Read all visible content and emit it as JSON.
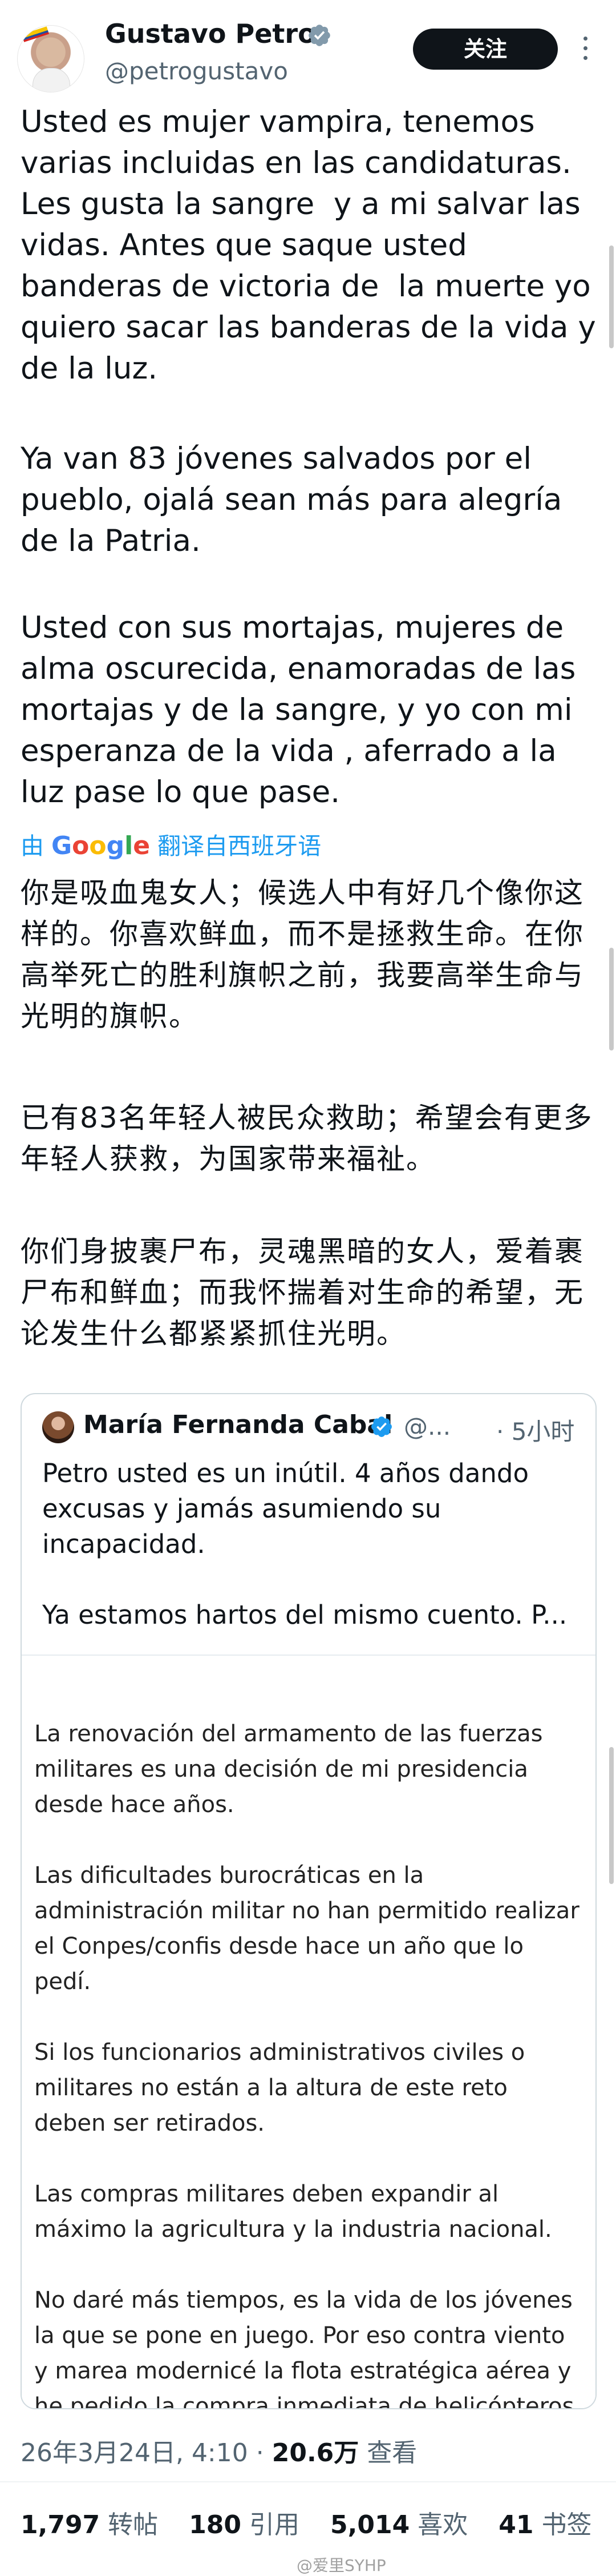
{
  "author": {
    "name": "Gustavo Petro",
    "handle": "@petrogustavo",
    "follow_label": "关注"
  },
  "tweet": {
    "para1": "Usted es mujer vampira, tenemos varias incluidas en las candidaturas. Les gusta la sangre  y a mi salvar las vidas. Antes que saque usted banderas de victoria de  la muerte yo quiero sacar las banderas de la vida y de la luz.",
    "para2": "Ya van 83 jóvenes salvados por el pueblo, ojalá sean más para alegría de la Patria.",
    "para3": "Usted con sus mortajas, mujeres de alma oscurecida, enamoradas de las mortajas y de la sangre, y yo con mi esperanza de la vida , aferrado a la luz pase lo que pase."
  },
  "translation": {
    "prefix": "由",
    "google": [
      "G",
      "o",
      "o",
      "g",
      "l",
      "e"
    ],
    "label": "翻译自西班牙语",
    "para1": "你是吸血鬼女人；候选人中有好几个像你这样的。你喜欢鲜血，而不是拯救生命。在你高举死亡的胜利旗帜之前，我要高举生命与光明的旗帜。",
    "para2": "已有83名年轻人被民众救助；希望会有更多年轻人获救，为国家带来福祉。",
    "para3": "你们身披裹尸布，灵魂黑暗的女人，爱着裹尸布和鲜血；而我怀揣着对生命的希望，无论发生什么都紧紧抓住光明。"
  },
  "quote": {
    "name": "María Fernanda Cabal",
    "handle": "@...",
    "time": "5小时",
    "text": "Petro usted es un inútil. 4 años dando excusas y jamás asumiendo su incapacidad.",
    "text2": "Ya estamos hartos del mismo cuento. P...",
    "image_text": "La renovación del armamento de las fuerzas militares es una decisión de mi presidencia desde hace años.\n\nLas dificultades burocráticas en la administración militar no han permitido realizar el Conpes/confis desde hace un año que lo pedí.\n\nSi los funcionarios administrativos civiles o militares no están a la altura de este reto deben ser retirados.\n\nLas compras militares deben expandir al máximo la agricultura y la industria nacional.\n\nNo daré más tiempos, es la vida de los jóvenes la que se pone en juego. Por eso contra viento y marea modernicé la flota estratégica aérea y he pedido la compra inmediata de helicópteros y aviones de carga y tropa para ampliar la capacidad de transporte y movilidad de tropas en"
  },
  "meta": {
    "date": "26年3月24日, 4:10 · ",
    "views": "20.6万",
    "views_label": " 查看"
  },
  "stats": {
    "retweets": "1,797",
    "retweets_label": " 转帖",
    "quotes": "180",
    "quotes_label": " 引用",
    "likes": "5,014",
    "likes_label": " 喜欢",
    "bookmarks": "41",
    "bookmarks_label": " 书签"
  },
  "watermark": "@爱里SYHP",
  "colors": {
    "accent": "#1d9bf0",
    "follow_bg": "#0f1419",
    "muted": "#536471"
  },
  "icons": [
    "verified-badge-icon",
    "more-options-icon",
    "google-logo"
  ]
}
